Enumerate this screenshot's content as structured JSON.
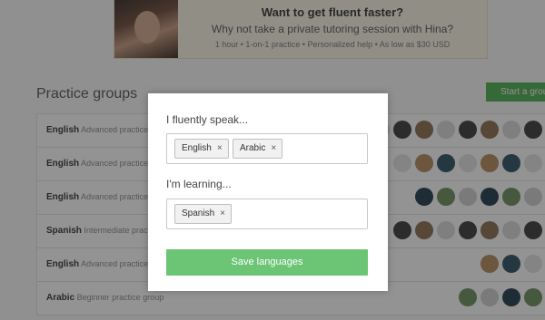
{
  "promo": {
    "title": "Want to get fluent faster?",
    "subtitle": "Why not take a private tutoring session with Hina?",
    "features": "1 hour • 1-on-1 practice • Personalized help • As low as $30 USD"
  },
  "practice_groups": {
    "title": "Practice groups",
    "start_button": "Start a group",
    "rows": [
      {
        "language": "English",
        "level": "Advanced practice group"
      },
      {
        "language": "English",
        "level": "Advanced practice group"
      },
      {
        "language": "English",
        "level": "Advanced practice group"
      },
      {
        "language": "Spanish",
        "level": "Intermediate practice group"
      },
      {
        "language": "English",
        "level": "Advanced practice group"
      },
      {
        "language": "Arabic",
        "level": "Beginner practice group"
      }
    ]
  },
  "modal": {
    "speak_label": "I fluently speak...",
    "speak_tags": [
      "English",
      "Arabic"
    ],
    "learning_label": "I'm learning...",
    "learning_tags": [
      "Spanish"
    ],
    "save_button": "Save languages",
    "remove_icon": "×"
  },
  "colors": {
    "save_button": "#6cc475",
    "start_button": "#4caf50",
    "overlay": "rgba(30,30,30,0.48)"
  }
}
